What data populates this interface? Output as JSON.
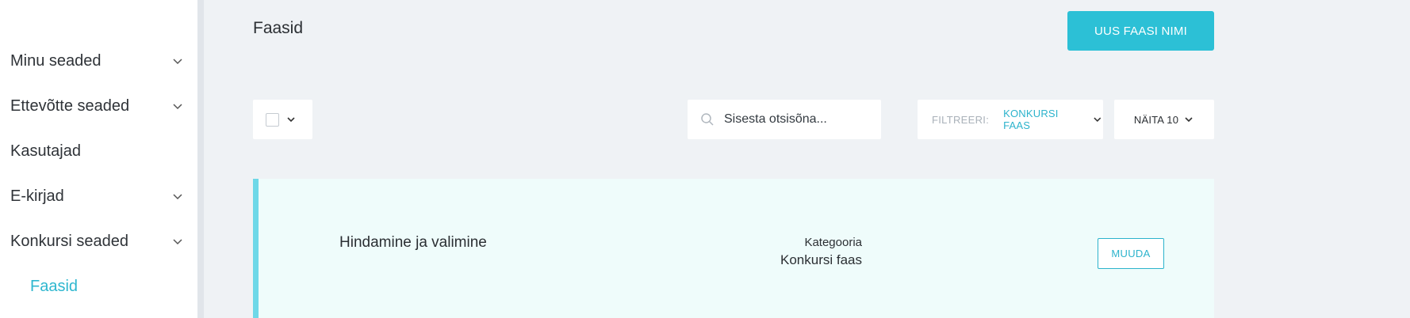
{
  "sidebar": {
    "items": [
      {
        "label": "Minu seaded",
        "has_chevron": true
      },
      {
        "label": "Ettevõtte seaded",
        "has_chevron": true
      },
      {
        "label": "Kasutajad",
        "has_chevron": false
      },
      {
        "label": "E-kirjad",
        "has_chevron": true
      },
      {
        "label": "Konkursi seaded",
        "has_chevron": true
      }
    ],
    "sub_item": {
      "label": "Faasid",
      "active": true
    }
  },
  "header": {
    "title": "Faasid",
    "new_button_label": "UUS FAASI NIMI"
  },
  "toolbar": {
    "search_placeholder": "Sisesta otsisõna...",
    "filter_label": "FILTREERI:",
    "filter_value": "KONKURSI FAAS",
    "show_label": "NÄITA 10"
  },
  "table": {
    "rows": [
      {
        "name": "Hindamine ja valimine",
        "category_label": "Kategooria",
        "category_value": "Konkursi faas",
        "edit_label": "MUUDA"
      }
    ]
  },
  "colors": {
    "accent": "#2cc0d6",
    "active_link": "#2fb7cf",
    "row_highlight": "#effcfb",
    "row_border": "#6ed8e8",
    "background": "#eff2f5"
  }
}
